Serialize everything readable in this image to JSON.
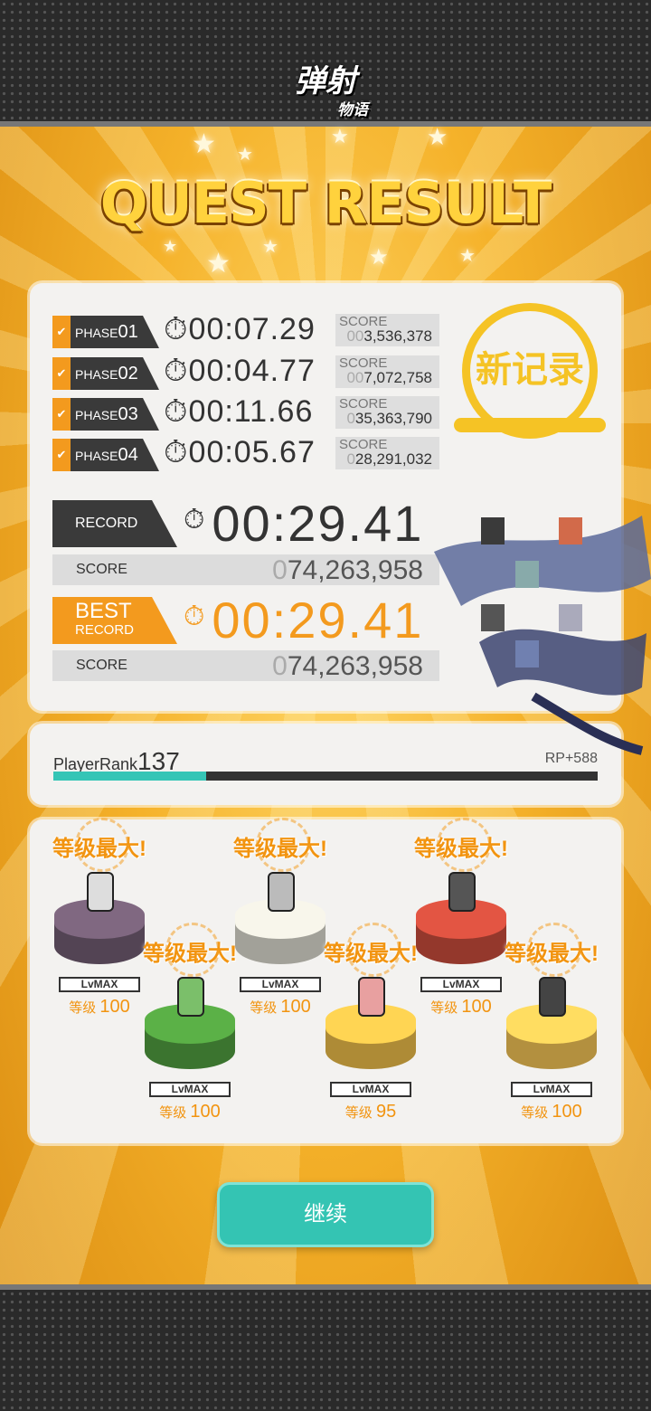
{
  "header": {
    "logo": "弹射",
    "logo_sub": "物语",
    "title": "QUEST RESULT"
  },
  "phases": [
    {
      "label": "PHASE",
      "num": "01",
      "time": "00:07.29",
      "score_label": "SCORE",
      "score_pad": "00",
      "score": "3,536,378"
    },
    {
      "label": "PHASE",
      "num": "02",
      "time": "00:04.77",
      "score_label": "SCORE",
      "score_pad": "00",
      "score": "7,072,758"
    },
    {
      "label": "PHASE",
      "num": "03",
      "time": "00:11.66",
      "score_label": "SCORE",
      "score_pad": "0",
      "score": "35,363,790"
    },
    {
      "label": "PHASE",
      "num": "04",
      "time": "00:05.67",
      "score_label": "SCORE",
      "score_pad": "0",
      "score": "28,291,032"
    }
  ],
  "stamp": "新记录",
  "record": {
    "label": "RECORD",
    "time": "00:29.41",
    "score_label": "SCORE",
    "score_pad": "0",
    "score": "74,263,958"
  },
  "best": {
    "label1": "BEST",
    "label2": "RECORD",
    "time": "00:29.41",
    "score_label": "SCORE",
    "score_pad": "0",
    "score": "74,263,958"
  },
  "rank": {
    "label": "PlayerRank",
    "value": "137",
    "rp": "RP+588",
    "progress": 0.28
  },
  "units": [
    {
      "max": "等级最大!",
      "lv": "LvMAX",
      "lv_label": "等级",
      "level": "100",
      "color": "#6f5a70"
    },
    {
      "max": "等级最大!",
      "lv": "LvMAX",
      "lv_label": "等级",
      "level": "100",
      "color": "#4f9a3e"
    },
    {
      "max": "等级最大!",
      "lv": "LvMAX",
      "lv_label": "等级",
      "level": "100",
      "color": "#d8d6cc"
    },
    {
      "max": "等级最大!",
      "lv": "LvMAX",
      "lv_label": "等级",
      "level": "95",
      "color": "#e8b948"
    },
    {
      "max": "等级最大!",
      "lv": "LvMAX",
      "lv_label": "等级",
      "level": "100",
      "color": "#c54a3a"
    },
    {
      "max": "等级最大!",
      "lv": "LvMAX",
      "lv_label": "等级",
      "level": "100",
      "color": "#efc054"
    }
  ],
  "continue_label": "继续",
  "colors": {
    "accent": "#f39a1e",
    "teal": "#34c4b3",
    "dark": "#3a3a3a"
  }
}
